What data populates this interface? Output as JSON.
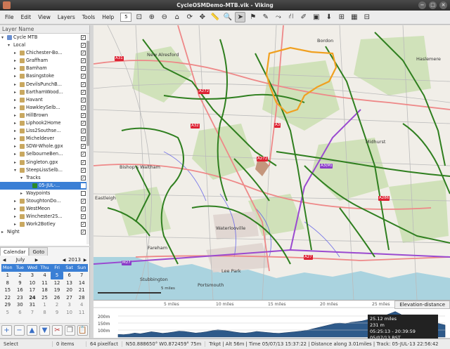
{
  "window": {
    "title": "CycleOSMDemo-MTB.vik - Viking"
  },
  "menu": [
    "File",
    "Edit",
    "View",
    "Layers",
    "Tools",
    "Help"
  ],
  "toolbar": {
    "zoom_value": "5",
    "tools": [
      "zoom-fit-icon",
      "zoom-in-icon",
      "zoom-out-icon",
      "home-icon",
      "refresh-icon",
      "pan-icon",
      "ruler-icon",
      "zoom-tool-icon",
      "select-pointer-icon",
      "create-trackpoint-icon",
      "edit-waypoint-icon",
      "create-route-icon",
      "route-finder-icon",
      "edit-trackpoint-icon",
      "show-picture-icon",
      "download-maps-icon",
      "georef-icon",
      "dem-download-icon",
      "split-view-icon"
    ]
  },
  "layers_panel": {
    "header": "Layer Name",
    "items": [
      {
        "label": "Cycle MTB",
        "indent": 1,
        "arrow": "down",
        "icon": "layers-icon",
        "checked": true
      },
      {
        "label": "Local",
        "indent": 2,
        "arrow": "down",
        "icon": "",
        "checked": true
      },
      {
        "label": "Chichester-Bo...",
        "indent": 3,
        "arrow": "right",
        "icon": "trw-icon",
        "checked": true
      },
      {
        "label": "Graffham",
        "indent": 3,
        "arrow": "right",
        "icon": "trw-icon",
        "checked": true
      },
      {
        "label": "Bamham",
        "indent": 3,
        "arrow": "right",
        "icon": "trw-icon",
        "checked": true
      },
      {
        "label": "Basingstoke",
        "indent": 3,
        "arrow": "right",
        "icon": "trw-icon",
        "checked": true
      },
      {
        "label": "DevilsPunchB...",
        "indent": 3,
        "arrow": "right",
        "icon": "trw-icon",
        "checked": true
      },
      {
        "label": "EarthamWood...",
        "indent": 3,
        "arrow": "right",
        "icon": "trw-icon",
        "checked": true
      },
      {
        "label": "Havant",
        "indent": 3,
        "arrow": "right",
        "icon": "trw-icon",
        "checked": true
      },
      {
        "label": "HawkleySelb...",
        "indent": 3,
        "arrow": "right",
        "icon": "trw-icon",
        "checked": true
      },
      {
        "label": "HillBrown",
        "indent": 3,
        "arrow": "right",
        "icon": "trw-icon",
        "checked": true
      },
      {
        "label": "Liphook2Home",
        "indent": 3,
        "arrow": "right",
        "icon": "trw-icon",
        "checked": true
      },
      {
        "label": "Liss2Southse...",
        "indent": 3,
        "arrow": "right",
        "icon": "trw-icon",
        "checked": true
      },
      {
        "label": "Micheldever",
        "indent": 3,
        "arrow": "right",
        "icon": "trw-icon",
        "checked": true
      },
      {
        "label": "SDW-Whole.gpx",
        "indent": 3,
        "arrow": "right",
        "icon": "trw-icon",
        "checked": true
      },
      {
        "label": "SelbourneBen...",
        "indent": 3,
        "arrow": "right",
        "icon": "trw-icon",
        "checked": true
      },
      {
        "label": "Singleton.gpx",
        "indent": 3,
        "arrow": "right",
        "icon": "trw-icon",
        "checked": true
      },
      {
        "label": "SteepLissSelb...",
        "indent": 3,
        "arrow": "down",
        "icon": "trw-icon",
        "checked": true
      },
      {
        "label": "Tracks",
        "indent": 4,
        "arrow": "down",
        "icon": "",
        "checked": true
      },
      {
        "label": "05-JUL-...",
        "indent": 5,
        "arrow": "",
        "icon": "track-color-icon",
        "checked": true,
        "selected": true
      },
      {
        "label": "Waypoints",
        "indent": 4,
        "arrow": "right",
        "icon": "",
        "checked": false
      },
      {
        "label": "StoughtonDo...",
        "indent": 3,
        "arrow": "right",
        "icon": "trw-icon",
        "checked": true
      },
      {
        "label": "WestMeon",
        "indent": 3,
        "arrow": "right",
        "icon": "trw-icon",
        "checked": true
      },
      {
        "label": "Winchester2S...",
        "indent": 3,
        "arrow": "right",
        "icon": "trw-icon",
        "checked": true
      },
      {
        "label": "Work2Botley",
        "indent": 3,
        "arrow": "right",
        "icon": "trw-icon",
        "checked": true
      },
      {
        "label": "Night",
        "indent": 1,
        "arrow": "right",
        "icon": "",
        "checked": true
      }
    ]
  },
  "calendar": {
    "tabs": [
      "Calendar",
      "Goto"
    ],
    "month": "July",
    "year": "2013",
    "day_headers": [
      "Mon",
      "Tue",
      "Wed",
      "Thu",
      "Fri",
      "Sat",
      "Sun"
    ],
    "days": [
      [
        "1",
        "2",
        "3",
        "4",
        "5",
        "6",
        "7"
      ],
      [
        "8",
        "9",
        "10",
        "11",
        "12",
        "13",
        "14"
      ],
      [
        "15",
        "16",
        "17",
        "18",
        "19",
        "20",
        "21"
      ],
      [
        "22",
        "23",
        "24",
        "25",
        "26",
        "27",
        "28"
      ],
      [
        "29",
        "30",
        "31",
        "1",
        "2",
        "3",
        "4"
      ],
      [
        "5",
        "6",
        "7",
        "8",
        "9",
        "10",
        "11"
      ]
    ],
    "selected_day": "5"
  },
  "left_tools": [
    "add-icon",
    "remove-icon",
    "move-up-icon",
    "move-down-icon",
    "cut-icon",
    "copy-icon",
    "paste-icon"
  ],
  "map": {
    "labels": [
      {
        "text": "New Alresford"
      },
      {
        "text": "Bordon"
      },
      {
        "text": "Haslemere"
      },
      {
        "text": "Bishop's Waltham"
      },
      {
        "text": "Midhurst"
      },
      {
        "text": "Waterlooville"
      },
      {
        "text": "Fareham"
      },
      {
        "text": "Portsmouth"
      },
      {
        "text": "Lee Park"
      },
      {
        "text": "Stubbington"
      },
      {
        "text": "Eastleigh"
      }
    ],
    "road_numbers": [
      {
        "text": "A31",
        "color": "red"
      },
      {
        "text": "A32",
        "color": "red"
      },
      {
        "text": "A272",
        "color": "red"
      },
      {
        "text": "A3",
        "color": "red"
      },
      {
        "text": "A286",
        "color": "red"
      },
      {
        "text": "A272",
        "color": "red"
      },
      {
        "text": "A27",
        "color": "red"
      },
      {
        "text": "M27",
        "color": "purple"
      },
      {
        "text": "A3(M)",
        "color": "purple"
      }
    ],
    "scale_text": "5 miles"
  },
  "elevation": {
    "tab_label": "Elevation-distance",
    "ruler_ticks": [
      "5 miles",
      "10 miles",
      "15 miles",
      "20 miles",
      "25 miles"
    ],
    "y_labels": [
      "200m",
      "150m",
      "100m"
    ],
    "tooltip_lines": [
      "25.12 miles",
      "231 m",
      "05:25:13 - 20:39:59 05/07/13 BST"
    ],
    "profile": [
      60,
      58,
      62,
      70,
      65,
      72,
      80,
      75,
      68,
      72,
      78,
      85,
      82,
      76,
      70,
      74,
      80,
      88,
      95,
      90,
      84,
      78,
      72,
      70,
      75,
      82,
      78,
      74,
      70,
      68,
      72,
      76,
      80,
      84,
      90,
      100,
      110,
      120,
      130,
      140,
      145,
      140,
      150,
      155,
      160,
      170,
      180,
      190,
      200,
      215,
      231,
      210,
      190,
      170,
      160,
      150,
      145,
      150,
      140,
      130
    ]
  },
  "status": {
    "mode": "Select",
    "items": "0 items",
    "zoom": "64 pixelfact",
    "coords": "N50.888650° W0.872459° 75m",
    "track_info": "Trkpt | Alt 56m | Time 05/07/13 15:37:22 | Distance along 3.01miles | Track: 05-JUL-13 22:56:42"
  }
}
